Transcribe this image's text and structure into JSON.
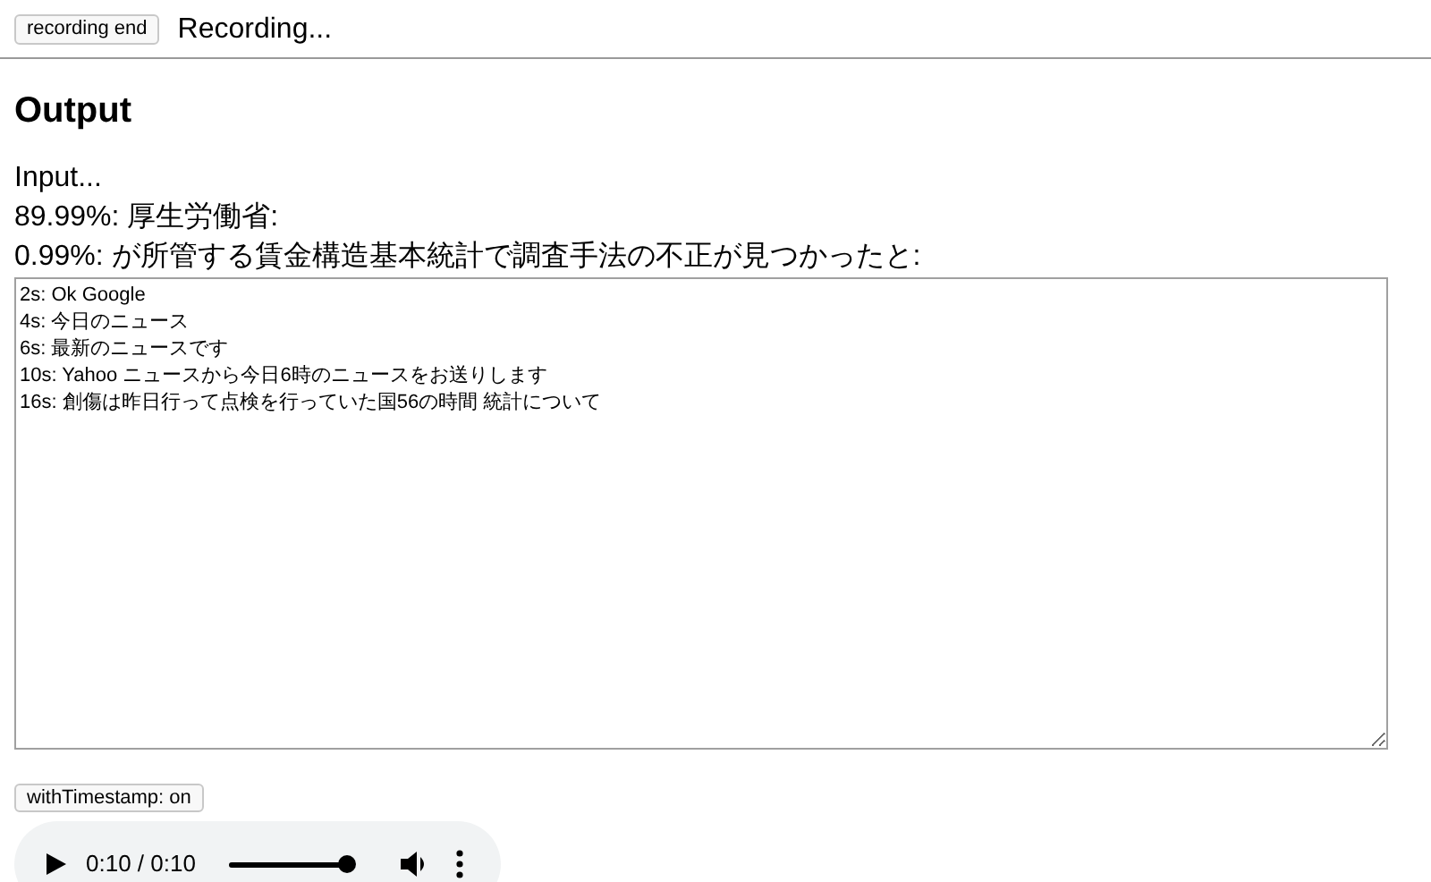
{
  "record_button": "recording end",
  "status": "Recording...",
  "heading": "Output",
  "results": [
    "Input...",
    "89.99%: 厚生労働省:",
    "0.99%: が所管する賃金構造基本統計で調査手法の不正が見つかったと:"
  ],
  "transcript": [
    "2s: Ok Google",
    "4s: 今日のニュース",
    "6s: 最新のニュースです",
    "10s: Yahoo ニュースから今日6時のニュースをお送りします",
    "16s: 創傷は昨日行って点検を行っていた国56の時間 統計について"
  ],
  "timestamp_button": "withTimestamp: on",
  "player": {
    "time": "0:10 / 0:10",
    "level": 1.0
  }
}
